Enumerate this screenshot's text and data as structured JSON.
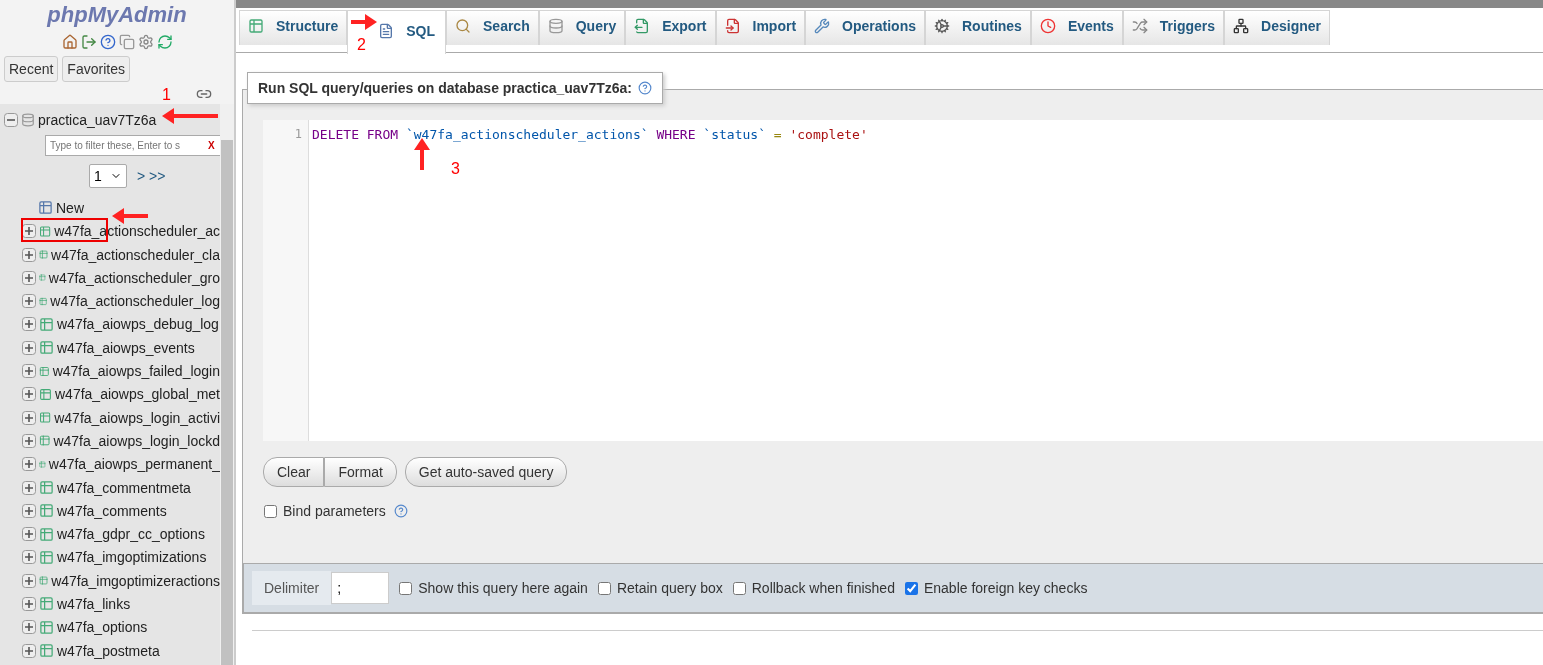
{
  "sidebar": {
    "logo": "phpMyAdmin",
    "buttons": [
      "Recent",
      "Favorites"
    ],
    "database": {
      "name": "practica_uav7Tz6a",
      "expanded": true,
      "filter_placeholder": "Type to filter these, Enter to s",
      "filter_clear": "X",
      "page_select": "1",
      "page_next": "> >>",
      "new_label": "New",
      "tables": [
        "w47fa_actionscheduler_ac",
        "w47fa_actionscheduler_cla",
        "w47fa_actionscheduler_gro",
        "w47fa_actionscheduler_log",
        "w47fa_aiowps_debug_log",
        "w47fa_aiowps_events",
        "w47fa_aiowps_failed_login",
        "w47fa_aiowps_global_met",
        "w47fa_aiowps_login_activi",
        "w47fa_aiowps_login_lockd",
        "w47fa_aiowps_permanent_",
        "w47fa_commentmeta",
        "w47fa_comments",
        "w47fa_gdpr_cc_options",
        "w47fa_imgoptimizations",
        "w47fa_imgoptimizeractions",
        "w47fa_links",
        "w47fa_options",
        "w47fa_postmeta"
      ]
    }
  },
  "tabs": [
    {
      "label": "Structure",
      "kind": "structure",
      "selected": false
    },
    {
      "label": "SQL",
      "kind": "sql",
      "selected": true
    },
    {
      "label": "Search",
      "kind": "search",
      "selected": false
    },
    {
      "label": "Query",
      "kind": "query",
      "selected": false
    },
    {
      "label": "Export",
      "kind": "export",
      "selected": false
    },
    {
      "label": "Import",
      "kind": "import",
      "selected": false
    },
    {
      "label": "Operations",
      "kind": "operations",
      "selected": false
    },
    {
      "label": "Routines",
      "kind": "routines",
      "selected": false
    },
    {
      "label": "Events",
      "kind": "events",
      "selected": false
    },
    {
      "label": "Triggers",
      "kind": "triggers",
      "selected": false
    },
    {
      "label": "Designer",
      "kind": "designer",
      "selected": false
    }
  ],
  "sql_panel": {
    "legend": "Run SQL query/queries on database practica_uav7Tz6a:",
    "line_number": "1",
    "query": [
      {
        "text": "DELETE FROM ",
        "kind": "keyword"
      },
      {
        "text": "`w47fa_actionscheduler_actions`",
        "kind": "identifier"
      },
      {
        "text": " WHERE ",
        "kind": "keyword"
      },
      {
        "text": "`status`",
        "kind": "identifier"
      },
      {
        "text": " = ",
        "kind": "operator"
      },
      {
        "text": "'complete'",
        "kind": "string"
      }
    ],
    "buttons": [
      "Clear",
      "Format"
    ],
    "autosave_button": "Get auto-saved query",
    "bind_parameters": {
      "label": "Bind parameters",
      "checked": false
    }
  },
  "footer": {
    "delimiter_label": "Delimiter",
    "delimiter_value": ";",
    "options": [
      {
        "label": "Show this query here again",
        "checked": false
      },
      {
        "label": "Retain query box",
        "checked": false
      },
      {
        "label": "Rollback when finished",
        "checked": false
      },
      {
        "label": "Enable foreign key checks",
        "checked": true
      }
    ]
  },
  "annotations": [
    {
      "number": "1",
      "kind": "database"
    },
    {
      "number": "2",
      "kind": "tab"
    },
    {
      "number": "3",
      "kind": "query"
    }
  ]
}
